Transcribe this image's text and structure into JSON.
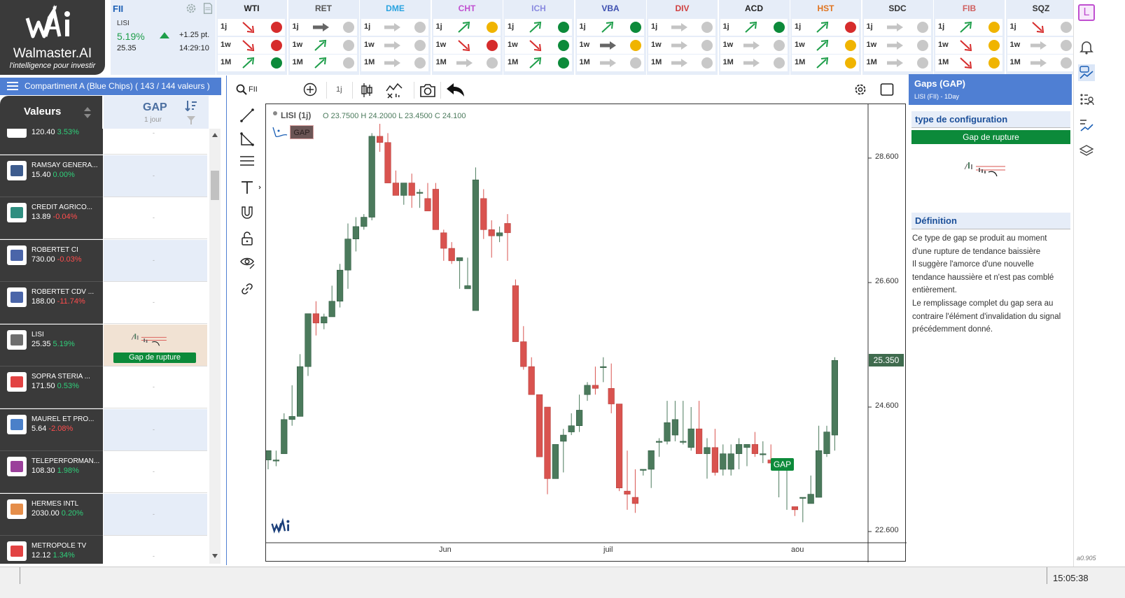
{
  "brand": {
    "name": "Walmaster.AI",
    "tagline": "l'intelligence pour investir"
  },
  "index": {
    "name": "FII",
    "symbol": "LISI",
    "change_pct": "5.19%",
    "change_pts": "+1.25 pt.",
    "price": "25.35",
    "time": "14:29:10"
  },
  "markets": [
    {
      "name": "WTI",
      "color": "#222222",
      "rows": [
        [
          "1j",
          "down",
          "red"
        ],
        [
          "1w",
          "down",
          "red"
        ],
        [
          "1M",
          "up",
          "green"
        ]
      ]
    },
    {
      "name": "RET",
      "color": "#555555",
      "rows": [
        [
          "1j",
          "flat-dark",
          "gray"
        ],
        [
          "1w",
          "up",
          "gray"
        ],
        [
          "1M",
          "up",
          "gray"
        ]
      ]
    },
    {
      "name": "DME",
      "color": "#29a3e0",
      "rows": [
        [
          "1j",
          "flat",
          "gray"
        ],
        [
          "1w",
          "flat",
          "gray"
        ],
        [
          "1M",
          "flat",
          "gray"
        ]
      ]
    },
    {
      "name": "CHT",
      "color": "#c04fd0",
      "rows": [
        [
          "1j",
          "up",
          "yellow"
        ],
        [
          "1w",
          "down",
          "red"
        ],
        [
          "1M",
          "flat",
          "gray"
        ]
      ]
    },
    {
      "name": "ICH",
      "color": "#8a8ae0",
      "rows": [
        [
          "1j",
          "up",
          "green"
        ],
        [
          "1w",
          "down",
          "green"
        ],
        [
          "1M",
          "up",
          "green"
        ]
      ]
    },
    {
      "name": "VBA",
      "color": "#3d4fb0",
      "rows": [
        [
          "1j",
          "up",
          "green"
        ],
        [
          "1w",
          "flat-dark",
          "yellow"
        ],
        [
          "1M",
          "flat",
          "gray"
        ]
      ]
    },
    {
      "name": "DIV",
      "color": "#d04040",
      "rows": [
        [
          "1j",
          "flat",
          "gray"
        ],
        [
          "1w",
          "flat",
          "gray"
        ],
        [
          "1M",
          "flat",
          "gray"
        ]
      ]
    },
    {
      "name": "ACD",
      "color": "#222222",
      "rows": [
        [
          "1j",
          "up",
          "green"
        ],
        [
          "1w",
          "flat",
          "gray"
        ],
        [
          "1M",
          "flat",
          "gray"
        ]
      ]
    },
    {
      "name": "HST",
      "color": "#e0741f",
      "rows": [
        [
          "1j",
          "up",
          "red"
        ],
        [
          "1w",
          "up",
          "yellow"
        ],
        [
          "1M",
          "up",
          "yellow"
        ]
      ]
    },
    {
      "name": "SDC",
      "color": "#333333",
      "rows": [
        [
          "1j",
          "flat",
          "gray"
        ],
        [
          "1w",
          "flat",
          "gray"
        ],
        [
          "1M",
          "flat",
          "gray"
        ]
      ]
    },
    {
      "name": "FIB",
      "color": "#d06060",
      "rows": [
        [
          "1j",
          "up",
          "yellow"
        ],
        [
          "1w",
          "down",
          "yellow"
        ],
        [
          "1M",
          "down",
          "yellow"
        ]
      ]
    },
    {
      "name": "SQZ",
      "color": "#333333",
      "rows": [
        [
          "1j",
          "down",
          "gray"
        ],
        [
          "1w",
          "flat",
          "gray"
        ],
        [
          "1M",
          "flat",
          "gray"
        ]
      ]
    }
  ],
  "compartment": "Compartiment A (Blue Chips) ( 143 / 144 valeurs )",
  "list_header": {
    "col1": "Valeurs",
    "col2": "GAP",
    "col2_sub": "1 jour"
  },
  "rows": [
    {
      "name": "",
      "price": "120.40",
      "pct": "3.53%",
      "dir": "pos",
      "gap": "-"
    },
    {
      "name": "RAMSAY GENERA...",
      "price": "15.40",
      "pct": "0.00%",
      "dir": "pos",
      "gap": "-"
    },
    {
      "name": "CREDIT AGRICO...",
      "price": "13.89",
      "pct": "-0.04%",
      "dir": "neg",
      "gap": "-"
    },
    {
      "name": "ROBERTET CI",
      "price": "730.00",
      "pct": "-0.03%",
      "dir": "neg",
      "gap": "-"
    },
    {
      "name": "ROBERTET CDV ...",
      "price": "188.00",
      "pct": "-11.74%",
      "dir": "neg",
      "gap": "-"
    },
    {
      "name": "LISI",
      "price": "25.35",
      "pct": "5.19%",
      "dir": "pos",
      "gap": "Gap de rupture"
    },
    {
      "name": "SOPRA STERIA ...",
      "price": "171.50",
      "pct": "0.53%",
      "dir": "pos",
      "gap": "-"
    },
    {
      "name": "MAUREL ET PRO...",
      "price": "5.64",
      "pct": "-2.08%",
      "dir": "neg",
      "gap": "-"
    },
    {
      "name": "TELEPERFORMAN...",
      "price": "108.30",
      "pct": "1.98%",
      "dir": "pos",
      "gap": "-"
    },
    {
      "name": "HERMES INTL",
      "price": "2030.00",
      "pct": "0.20%",
      "dir": "pos",
      "gap": "-"
    },
    {
      "name": "METROPOLE TV",
      "price": "12.12",
      "pct": "1.34%",
      "dir": "pos",
      "gap": "-"
    }
  ],
  "toolbar": {
    "search": "FII",
    "interval": "1j"
  },
  "chart": {
    "legend": "LISI (1j)",
    "ohlc": "O 23.7500 H 24.2000 L 23.4500 C 24.100",
    "study_tag": "GAP",
    "marker": "GAP",
    "last_price": "25.350",
    "y_ticks": [
      "28.600",
      "26.600",
      "24.600",
      "22.600"
    ],
    "x_ticks": [
      "Jun",
      "juil",
      "aou"
    ]
  },
  "chart_data": {
    "type": "candlestick",
    "ylim": [
      21.95,
      29.2
    ],
    "y_ticks": [
      28.6,
      26.6,
      24.6,
      22.6
    ],
    "x_ticks": [
      "Jun",
      "juil",
      "aou"
    ],
    "last_price": 25.35,
    "candles": [
      [
        23.75,
        23.9,
        23.6,
        23.9
      ],
      [
        23.75,
        23.9,
        23.65,
        23.75
      ],
      [
        23.85,
        24.5,
        23.85,
        24.4
      ],
      [
        24.4,
        24.95,
        24.3,
        24.45
      ],
      [
        24.45,
        25.45,
        24.45,
        25.25
      ],
      [
        25.25,
        26.1,
        25.1,
        26.1
      ],
      [
        26.1,
        26.3,
        25.75,
        25.95
      ],
      [
        25.95,
        26.1,
        25.85,
        26.05
      ],
      [
        26.05,
        26.55,
        26.05,
        26.3
      ],
      [
        26.3,
        26.9,
        26.2,
        26.8
      ],
      [
        26.8,
        27.55,
        26.5,
        27.3
      ],
      [
        27.3,
        27.65,
        27.1,
        27.5
      ],
      [
        27.5,
        27.7,
        27.45,
        27.65
      ],
      [
        27.65,
        29.0,
        27.6,
        28.95
      ],
      [
        28.95,
        29.15,
        28.7,
        28.85
      ],
      [
        28.85,
        29.0,
        28.2,
        28.2
      ],
      [
        28.2,
        28.4,
        28.0,
        28.0
      ],
      [
        28.0,
        28.05,
        27.85,
        28.2
      ],
      [
        28.2,
        28.35,
        27.8,
        28.0
      ],
      [
        28.05,
        28.1,
        27.8,
        28.05
      ],
      [
        27.95,
        28.2,
        27.75,
        27.75
      ],
      [
        28.1,
        28.2,
        27.55,
        27.45
      ],
      [
        27.4,
        27.45,
        26.95,
        27.15
      ],
      [
        27.15,
        27.25,
        26.9,
        26.95
      ],
      [
        26.95,
        27.0,
        26.5,
        27.0
      ],
      [
        26.5,
        27.0,
        26.5,
        26.55
      ],
      [
        26.15,
        28.45,
        26.15,
        28.25
      ],
      [
        27.95,
        28.1,
        27.3,
        27.45
      ],
      [
        27.45,
        27.6,
        27.0,
        27.35
      ],
      [
        27.35,
        27.5,
        27.25,
        27.4
      ],
      [
        27.55,
        27.7,
        26.95,
        27.4
      ],
      [
        26.55,
        26.65,
        25.65,
        25.65
      ],
      [
        25.65,
        25.9,
        25.2,
        25.25
      ],
      [
        25.25,
        25.4,
        24.8,
        24.8
      ],
      [
        24.8,
        24.8,
        23.8,
        23.8
      ],
      [
        24.6,
        24.6,
        23.2,
        23.45
      ],
      [
        23.45,
        24.0,
        23.45,
        24.0
      ],
      [
        24.05,
        24.25,
        23.55,
        24.15
      ],
      [
        24.2,
        24.5,
        24.15,
        24.3
      ],
      [
        24.3,
        24.8,
        24.2,
        24.55
      ],
      [
        24.8,
        25.0,
        24.7,
        24.95
      ],
      [
        24.95,
        25.25,
        24.8,
        24.9
      ],
      [
        25.25,
        25.4,
        25.0,
        25.25
      ],
      [
        24.9,
        25.3,
        24.5,
        24.65
      ],
      [
        24.65,
        24.65,
        23.25,
        23.3
      ],
      [
        23.25,
        23.9,
        22.95,
        23.2
      ],
      [
        23.15,
        23.6,
        22.9,
        23.05
      ],
      [
        23.6,
        23.6,
        23.5,
        23.6
      ],
      [
        23.6,
        23.9,
        23.3,
        23.9
      ],
      [
        24.05,
        24.1,
        23.8,
        24.05
      ],
      [
        24.05,
        24.7,
        24.0,
        24.35
      ],
      [
        24.15,
        24.7,
        24.05,
        24.4
      ],
      [
        24.05,
        24.7,
        24.0,
        24.05
      ],
      [
        23.95,
        24.6,
        23.9,
        24.25
      ],
      [
        24.25,
        24.7,
        23.85,
        23.85
      ],
      [
        23.85,
        24.1,
        23.45,
        23.95
      ],
      [
        23.95,
        24.25,
        23.5,
        23.55
      ],
      [
        23.6,
        24.0,
        23.5,
        23.85
      ],
      [
        23.6,
        24.0,
        23.5,
        23.85
      ],
      [
        23.85,
        24.1,
        23.6,
        24.0
      ],
      [
        23.95,
        24.0,
        23.65,
        24.0
      ],
      [
        24.0,
        24.2,
        23.8,
        23.85
      ],
      [
        23.85,
        24.05,
        23.7,
        23.85
      ],
      [
        23.75,
        24.0,
        23.7,
        23.7
      ],
      [
        23.65,
        23.7,
        23.15,
        23.7
      ],
      [
        23.6,
        23.6,
        22.95,
        23.65
      ],
      [
        23.0,
        23.0,
        22.85,
        22.95
      ],
      [
        23.15,
        23.15,
        22.75,
        23.15
      ],
      [
        23.05,
        23.5,
        23.05,
        23.2
      ],
      [
        23.15,
        24.3,
        23.15,
        23.9
      ],
      [
        23.85,
        24.3,
        23.8,
        24.2
      ],
      [
        24.15,
        25.4,
        23.9,
        25.35
      ]
    ]
  },
  "right_panel": {
    "title": "Gaps (GAP)",
    "subtitle": "LISI (FII) - 1Day",
    "section1": "type de configuration",
    "config": "Gap de rupture",
    "section2": "Définition",
    "definition_lines": [
      "Ce type de gap se produit au moment",
      "d'une rupture de tendance baissière",
      "Il suggère l'amorce d'une nouvelle",
      "tendance haussière et n'est pas comblé",
      "entièrement.",
      "Le remplissage complet du gap sera au",
      "contraire l'élément d'invalidation du signal",
      "précédemment donné."
    ]
  },
  "side_version": "a0.905",
  "user_initial": "L",
  "clock": "15:05:38",
  "colors": {
    "accent": "#4f7fd3",
    "up": "#4b7a5c",
    "down": "#d9534f",
    "signal_green": "#0c8a3a"
  }
}
